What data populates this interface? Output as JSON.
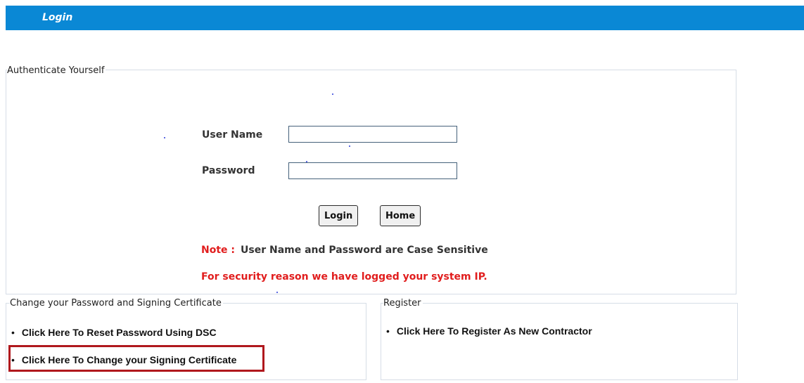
{
  "header": {
    "title": "Login"
  },
  "auth": {
    "legend": "Authenticate Yourself",
    "username": {
      "label": "User Name",
      "value": "",
      "placeholder": ""
    },
    "password": {
      "label": "Password",
      "value": "",
      "placeholder": ""
    },
    "login_button": "Login",
    "home_button": "Home",
    "note_key": "Note :",
    "note_text": "User Name and Password are Case Sensitive",
    "security_notice": "For security reason we have logged your system IP."
  },
  "change_section": {
    "legend": "Change your Password and Signing Certificate",
    "bullet": "•",
    "links": [
      "Click Here To Reset Password Using DSC",
      "Click Here To Change your Signing Certificate"
    ]
  },
  "register_section": {
    "legend": "Register",
    "bullet": "•",
    "links": [
      "Click Here To Register As New Contractor"
    ]
  },
  "colors": {
    "header_bg": "#0a88d5",
    "warning_red": "#e11d1d",
    "highlight_border": "#b0181d"
  }
}
